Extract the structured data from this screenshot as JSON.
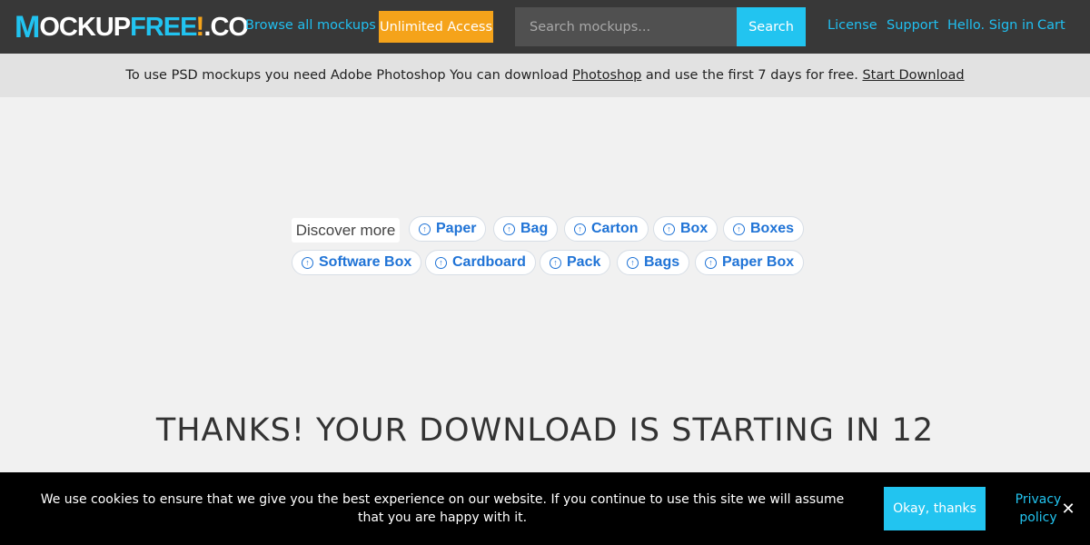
{
  "logo": {
    "part_m": "M",
    "part_white": "OCKUP",
    "part_blue": "FREE",
    "part_excl": "!",
    "part_co": ".CO"
  },
  "nav": {
    "browse": "Browse all mockups",
    "unlimited": "Unlimited Access",
    "search_placeholder": "Search mockups...",
    "search_button": "Search",
    "license": "License",
    "support": "Support",
    "signin": "Hello. Sign in",
    "cart": "Cart"
  },
  "notice": {
    "text_before": "To use PSD mockups you need Adobe Photoshop You can download",
    "photoshop_link": "Photoshop",
    "text_middle": "and use the first 7 days for free.",
    "download_link": "Start Download"
  },
  "discover": {
    "label": "Discover more",
    "chips": [
      "Paper",
      "Bag",
      "Carton",
      "Box",
      "Boxes",
      "Software Box",
      "Cardboard",
      "Pack",
      "Bags",
      "Paper Box"
    ]
  },
  "heading": "THANKS! YOUR DOWNLOAD IS STARTING IN 12",
  "cookie": {
    "text": "We use cookies to ensure that we give you the best experience on our website. If you continue to use this site we will assume that you are happy with it.",
    "ok_button": "Okay, thanks",
    "privacy": "Privacy policy",
    "close": "✕"
  },
  "colors": {
    "accent": "#22c4f0",
    "orange": "#f5a31a",
    "topbar": "#383838",
    "chip_text": "#1f73d6"
  },
  "icons": {
    "chip_icon": "arrow-circle-up-icon",
    "close_icon": "close-icon"
  }
}
